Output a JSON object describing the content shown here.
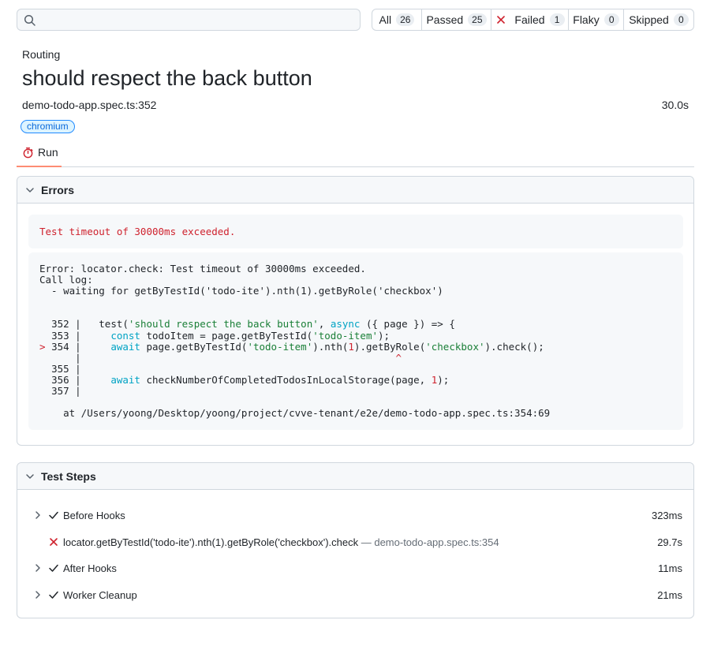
{
  "search": {
    "value": "",
    "placeholder": ""
  },
  "filters": [
    {
      "label": "All",
      "count": "26"
    },
    {
      "label": "Passed",
      "count": "25"
    },
    {
      "label": "Failed",
      "count": "1"
    },
    {
      "label": "Flaky",
      "count": "0"
    },
    {
      "label": "Skipped",
      "count": "0"
    }
  ],
  "test": {
    "suite": "Routing",
    "title": "should respect the back button",
    "location": "demo-todo-app.spec.ts:352",
    "duration": "30.0s",
    "project_label": "chromium"
  },
  "tabs": [
    {
      "label": "Run"
    }
  ],
  "errors": {
    "header": "Errors",
    "message": "Test timeout of 30000ms exceeded.",
    "lines": [
      "Error: locator.check: Test timeout of 30000ms exceeded.",
      "Call log:",
      "  - waiting for getByTestId('todo-ite').nth(1).getByRole('checkbox')"
    ],
    "code": {
      "l352": {
        "no": "352",
        "pre": "test(",
        "s1": "'should respect the back button'",
        "mid": ", ",
        "kw": "async",
        "post": " ({ page }) => {"
      },
      "l353": {
        "no": "353",
        "kw": "const",
        "pre": " todoItem = page.getByTestId(",
        "s1": "'todo-item'",
        "post": ");"
      },
      "l354": {
        "marker": ">",
        "no": "354",
        "kw": "await",
        "pre": " page.getByTestId(",
        "s1": "'todo-item'",
        "mid1": ").nth(",
        "num": "1",
        "mid2": ").getByRole(",
        "s2": "'checkbox'",
        "post": ").check();"
      },
      "caret": "^",
      "l355": {
        "no": "355"
      },
      "l356": {
        "no": "356",
        "kw": "await",
        "pre": " checkNumberOfCompletedTodosInLocalStorage(page, ",
        "num": "1",
        "post": ");"
      },
      "l357": {
        "no": "357"
      }
    },
    "stack": "at /Users/yoong/Desktop/yoong/project/cvve-tenant/e2e/demo-todo-app.spec.ts:354:69"
  },
  "steps": {
    "header": "Test Steps",
    "items": [
      {
        "title": "Before Hooks",
        "location": "",
        "time": "323ms",
        "status": "passed"
      },
      {
        "title": "locator.getByTestId('todo-ite').nth(1).getByRole('checkbox').check",
        "location": "— demo-todo-app.spec.ts:354",
        "time": "29.7s",
        "status": "failed"
      },
      {
        "title": "After Hooks",
        "location": "",
        "time": "11ms",
        "status": "passed"
      },
      {
        "title": "Worker Cleanup",
        "location": "",
        "time": "21ms",
        "status": "passed"
      }
    ]
  },
  "colors": {
    "failed": "#cf222e",
    "string": "#1a7f37",
    "keyword": "#00a3c4",
    "chip": "#0969da"
  },
  "icons": [
    "search-icon",
    "close-icon",
    "stopwatch-icon",
    "chevron-down-icon",
    "chevron-right-icon",
    "check-icon"
  ]
}
